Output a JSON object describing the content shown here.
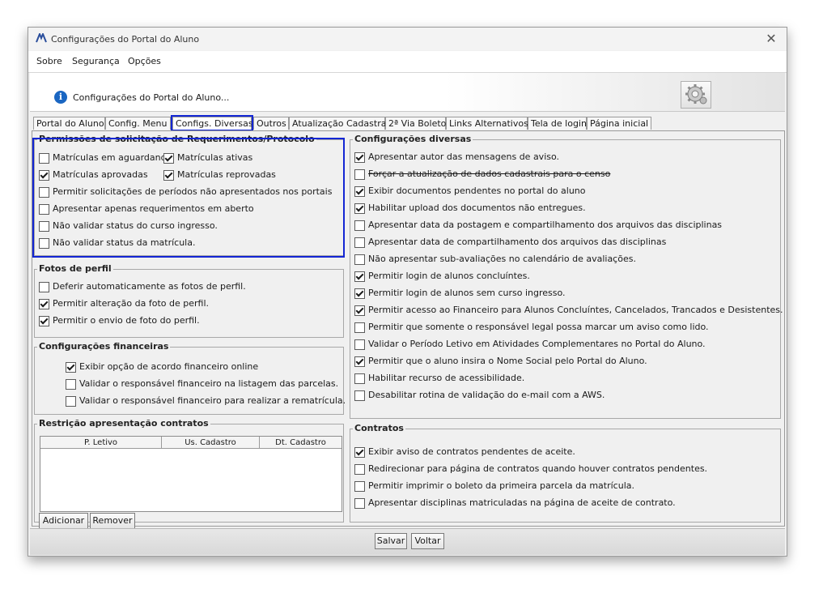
{
  "window": {
    "title": "Configurações do Portal do Aluno"
  },
  "menu": [
    "Sobre",
    "Segurança",
    "Opções"
  ],
  "header": {
    "title": "Configurações do Portal do Aluno..."
  },
  "tabs": [
    "Portal do Aluno",
    "Config. Menu",
    "Configs. Diversas",
    "Outros",
    "Atualização Cadastral",
    "2ª Via Boleto",
    "Links Alternativos",
    "Tela de login",
    "Página inicial"
  ],
  "active_tab": "Configs. Diversas",
  "permissoes": {
    "title": "Permissões de solicitação de Requerimentos/Protocolo",
    "items": [
      {
        "label": "Matrículas em aguardando",
        "checked": false
      },
      {
        "label": "Matrículas ativas",
        "checked": true
      },
      {
        "label": "Matrículas aprovadas",
        "checked": true
      },
      {
        "label": "Matrículas reprovadas",
        "checked": true
      },
      {
        "label": "Permitir solicitações de períodos não apresentados nos portais",
        "checked": false
      },
      {
        "label": "Apresentar apenas requerimentos em aberto",
        "checked": false
      },
      {
        "label": "Não validar status do curso ingresso.",
        "checked": false
      },
      {
        "label": "Não validar status da matrícula.",
        "checked": false
      }
    ]
  },
  "fotos": {
    "title": "Fotos de perfil",
    "items": [
      {
        "label": "Deferir automaticamente as fotos de perfil.",
        "checked": false
      },
      {
        "label": "Permitir alteração da foto de perfil.",
        "checked": true
      },
      {
        "label": "Permitir o envio de foto do perfil.",
        "checked": true
      }
    ]
  },
  "financeiras": {
    "title": "Configurações financeiras",
    "items": [
      {
        "label": "Exibir opção de acordo financeiro online",
        "checked": true
      },
      {
        "label": "Validar o responsável financeiro na listagem das parcelas.",
        "checked": false
      },
      {
        "label": "Validar o responsável financeiro para realizar a rematrícula.",
        "checked": false
      }
    ]
  },
  "contratos_restricao": {
    "title": "Restrição apresentação contratos",
    "columns": [
      "P. Letivo",
      "Us. Cadastro",
      "Dt. Cadastro"
    ],
    "add_label": "Adicionar",
    "remove_label": "Remover"
  },
  "diversas": {
    "title": "Configurações diversas",
    "items": [
      {
        "label": "Apresentar autor das mensagens de aviso.",
        "checked": true
      },
      {
        "label": "Forçar a atualização de dados cadastrais para o censo",
        "checked": false,
        "strike": true
      },
      {
        "label": "Exibir documentos pendentes no portal do aluno",
        "checked": true
      },
      {
        "label": "Habilitar upload dos documentos não entregues.",
        "checked": true
      },
      {
        "label": "Apresentar data da postagem e compartilhamento dos arquivos das disciplinas",
        "checked": false
      },
      {
        "label": "Apresentar data de compartilhamento dos arquivos das disciplinas",
        "checked": false
      },
      {
        "label": "Não apresentar sub-avaliações no calendário de avaliações.",
        "checked": false
      },
      {
        "label": "Permitir login de alunos concluíntes.",
        "checked": true
      },
      {
        "label": "Permitir login de alunos sem curso ingresso.",
        "checked": true
      },
      {
        "label": "Permitir acesso ao Financeiro para Alunos Concluíntes, Cancelados, Trancados e Desistentes.",
        "checked": true
      },
      {
        "label": "Permitir que somente o responsável legal possa marcar um aviso como lido.",
        "checked": false
      },
      {
        "label": "Validar o Período Letivo em Atividades Complementares no Portal do Aluno.",
        "checked": false
      },
      {
        "label": "Permitir que o aluno insira o Nome Social pelo Portal do Aluno.",
        "checked": true
      },
      {
        "label": "Habilitar recurso de acessibilidade.",
        "checked": false
      },
      {
        "label": "Desabilitar rotina de validação do e-mail com a AWS.",
        "checked": false
      }
    ]
  },
  "contratos": {
    "title": "Contratos",
    "items": [
      {
        "label": "Exibir aviso de contratos pendentes de aceite.",
        "checked": true
      },
      {
        "label": "Redirecionar para página de contratos quando houver contratos pendentes.",
        "checked": false
      },
      {
        "label": "Permitir imprimir o boleto da primeira parcela da matrícula.",
        "checked": false
      },
      {
        "label": "Apresentar disciplinas matriculadas na página de aceite de contrato.",
        "checked": false
      }
    ]
  },
  "footer": {
    "save_label": "Salvar",
    "back_label": "Voltar"
  },
  "colors": {
    "highlight": "#1326d4",
    "info_icon": "#1a66c2"
  }
}
